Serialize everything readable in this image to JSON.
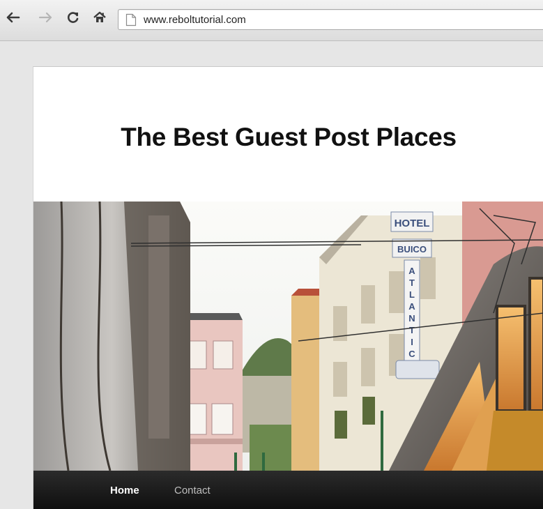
{
  "browser": {
    "url": "www.reboltutorial.com",
    "back_icon": "back-arrow-icon",
    "forward_icon": "forward-arrow-icon",
    "reload_icon": "reload-icon",
    "home_icon": "home-icon",
    "page_icon": "page-icon"
  },
  "site": {
    "title": "The Best Guest Post Places",
    "header_image": "street-with-tram-photo"
  },
  "nav": {
    "items": [
      {
        "label": "Home",
        "active": true
      },
      {
        "label": "Contact",
        "active": false
      }
    ]
  },
  "colors": {
    "navbar": "#141414",
    "nav_active": "#ffffff",
    "nav_inactive": "#bfbfbf"
  }
}
